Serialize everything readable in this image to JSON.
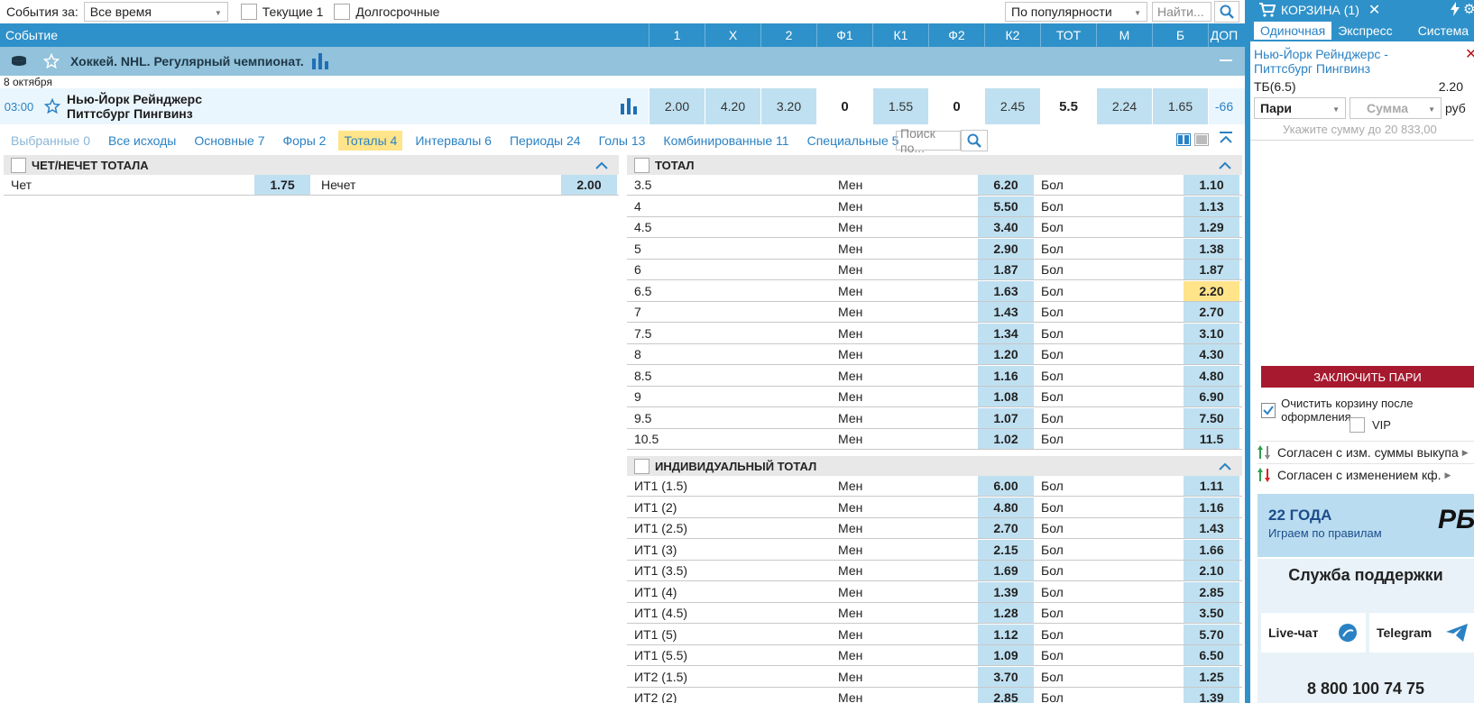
{
  "filters": {
    "events_label": "События за:",
    "period_value": "Все время",
    "current_label": "Текущие 1",
    "longterm_label": "Долгосрочные",
    "sort_value": "По популярности",
    "search_placeholder": "Найти..."
  },
  "header": {
    "title": "Событие",
    "columns": [
      "1",
      "X",
      "2",
      "Ф1",
      "К1",
      "Ф2",
      "К2",
      "ТОТ",
      "М",
      "Б",
      "ДОП"
    ]
  },
  "league": {
    "title": "Хоккей. NHL. Регулярный чемпионат."
  },
  "date": "8 октября",
  "event": {
    "time": "03:00",
    "team1": "Нью-Йорк Рейнджерс",
    "team2": "Питтсбург Пингвинз",
    "odds": [
      "2.00",
      "4.20",
      "3.20",
      "0",
      "1.55",
      "0",
      "2.45",
      "5.5",
      "2.24",
      "1.65",
      "-66"
    ]
  },
  "market_tabs": [
    {
      "label": "Выбранные 0"
    },
    {
      "label": "Все исходы"
    },
    {
      "label": "Основные 7"
    },
    {
      "label": "Форы 2"
    },
    {
      "label": "Тоталы 4"
    },
    {
      "label": "Интервалы 6"
    },
    {
      "label": "Периоды 24"
    },
    {
      "label": "Голы 13"
    },
    {
      "label": "Комбинированные 11"
    },
    {
      "label": "Специальные 5"
    }
  ],
  "market_search_placeholder": "Поиск по...",
  "odd_even": {
    "title": "ЧЕТ/НЕЧЕТ ТОТАЛА",
    "even_label": "Чет",
    "even_odd": "1.75",
    "odd_label": "Нечет",
    "odd_odd": "2.00"
  },
  "total": {
    "title": "ТОТАЛ",
    "under_label": "Мен",
    "over_label": "Бол",
    "rows": [
      {
        "line": "3.5",
        "under": "6.20",
        "over": "1.10"
      },
      {
        "line": "4",
        "under": "5.50",
        "over": "1.13"
      },
      {
        "line": "4.5",
        "under": "3.40",
        "over": "1.29"
      },
      {
        "line": "5",
        "under": "2.90",
        "over": "1.38"
      },
      {
        "line": "6",
        "under": "1.87",
        "over": "1.87"
      },
      {
        "line": "6.5",
        "under": "1.63",
        "over": "2.20"
      },
      {
        "line": "7",
        "under": "1.43",
        "over": "2.70"
      },
      {
        "line": "7.5",
        "under": "1.34",
        "over": "3.10"
      },
      {
        "line": "8",
        "under": "1.20",
        "over": "4.30"
      },
      {
        "line": "8.5",
        "under": "1.16",
        "over": "4.80"
      },
      {
        "line": "9",
        "under": "1.08",
        "over": "6.90"
      },
      {
        "line": "9.5",
        "under": "1.07",
        "over": "7.50"
      },
      {
        "line": "10.5",
        "under": "1.02",
        "over": "11.5"
      }
    ]
  },
  "ind_total": {
    "title": "ИНДИВИДУАЛЬНЫЙ ТОТАЛ",
    "rows": [
      {
        "line": "ИТ1 (1.5)",
        "under": "6.00",
        "over": "1.11"
      },
      {
        "line": "ИТ1 (2)",
        "under": "4.80",
        "over": "1.16"
      },
      {
        "line": "ИТ1 (2.5)",
        "under": "2.70",
        "over": "1.43"
      },
      {
        "line": "ИТ1 (3)",
        "under": "2.15",
        "over": "1.66"
      },
      {
        "line": "ИТ1 (3.5)",
        "under": "1.69",
        "over": "2.10"
      },
      {
        "line": "ИТ1 (4)",
        "under": "1.39",
        "over": "2.85"
      },
      {
        "line": "ИТ1 (4.5)",
        "under": "1.28",
        "over": "3.50"
      },
      {
        "line": "ИТ1 (5)",
        "under": "1.12",
        "over": "5.70"
      },
      {
        "line": "ИТ1 (5.5)",
        "under": "1.09",
        "over": "6.50"
      },
      {
        "line": "ИТ2 (1.5)",
        "under": "3.70",
        "over": "1.25"
      },
      {
        "line": "ИТ2 (2)",
        "under": "2.85",
        "over": "1.39"
      }
    ]
  },
  "basket": {
    "title": "КОРЗИНА (1)",
    "tabs": [
      "Одиночная",
      "Экспресс",
      "Система"
    ],
    "event": "Нью-Йорк Рейнджерс - Питтсбург Пингвинз",
    "bet_type": "ТБ(6.5)",
    "bet_odd": "2.20",
    "bet_select": "Пари",
    "sum_placeholder": "Сумма",
    "currency": "руб",
    "hint": "Укажите сумму до 20 833,00",
    "place_button": "ЗАКЛЮЧИТЬ ПАРИ",
    "clear_label": "Очистить корзину после оформления",
    "vip_label": "VIP",
    "agree_buyout": "Согласен с изм. суммы выкупа",
    "agree_odds": "Согласен с изменением кф."
  },
  "promo": {
    "years": "22 ГОДА",
    "sub": "Играем по правилам",
    "logo": "РБ"
  },
  "support": {
    "title": "Служба поддержки",
    "livechat": "Live-чат",
    "telegram": "Telegram",
    "phone": "8 800 100 74 75"
  },
  "colors": {
    "primary": "#2f91c9",
    "odd_bg": "#bfe0f1",
    "highlight": "#ffe48a",
    "place_bet": "#a6192e"
  },
  "highlighted_total_line": "6.5"
}
